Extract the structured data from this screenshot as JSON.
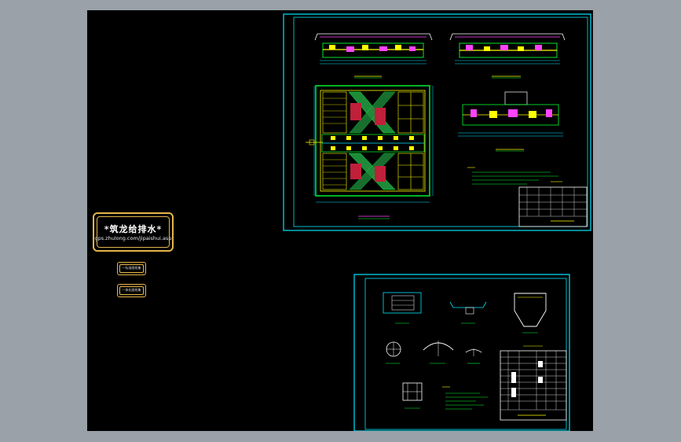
{
  "viewer": {
    "background_color": "#9aa1a8",
    "canvas_color": "#000000"
  },
  "logo": {
    "title": "*筑龙给排水*",
    "url": "gps.zhulong.com/jipaishui.asp"
  },
  "tags": [
    {
      "label": "一标准图纸集"
    },
    {
      "label": "一体化图纸集"
    }
  ],
  "sheet_main": {
    "frame_color": "#00e5ff",
    "line_color": "#00ff33"
  },
  "sheet_detail": {
    "frame_color": "#00e5ff",
    "line_color": "#00ff33"
  }
}
